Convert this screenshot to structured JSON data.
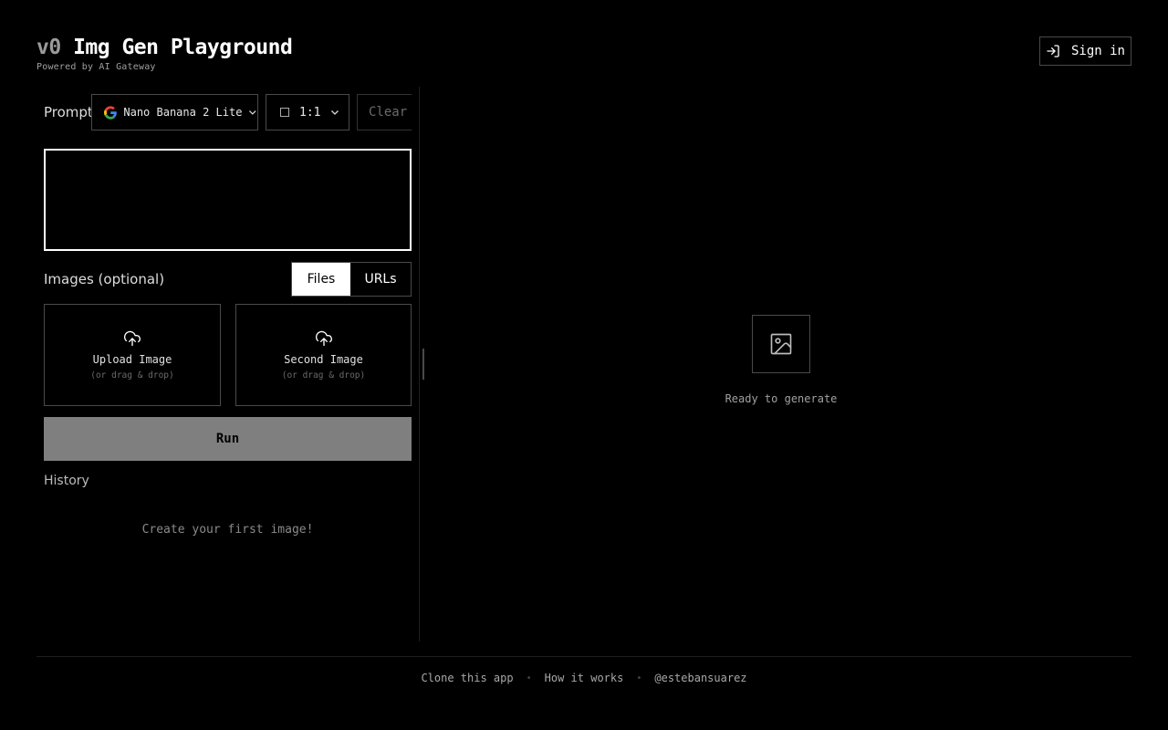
{
  "header": {
    "brand": "v0",
    "title": "Img Gen Playground",
    "powered_by": "Powered by AI Gateway",
    "sign_in": "Sign in"
  },
  "toolbar": {
    "prompt_label": "Prompt",
    "model": "Nano Banana 2 Lite",
    "aspect_ratio": "1:1",
    "clear": "Clear"
  },
  "prompt": {
    "value": "",
    "placeholder": ""
  },
  "images": {
    "label": "Images (optional)",
    "tabs": [
      {
        "label": "Files",
        "selected": true
      },
      {
        "label": "URLs",
        "selected": false
      }
    ],
    "uploads": [
      {
        "title": "Upload Image",
        "sub": "(or drag & drop)"
      },
      {
        "title": "Second Image",
        "sub": "(or drag & drop)"
      }
    ]
  },
  "run": "Run",
  "history": {
    "label": "History",
    "empty": "Create your first image!"
  },
  "preview": {
    "status": "Ready to generate"
  },
  "footer": {
    "links": [
      "Clone this app",
      "How it works",
      "@estebansuarez"
    ],
    "separator": "•"
  },
  "colors": {
    "background": "#000000",
    "border": "#4a4a4a",
    "run_button": "#7f7f7f",
    "accent": "#ffffff"
  }
}
